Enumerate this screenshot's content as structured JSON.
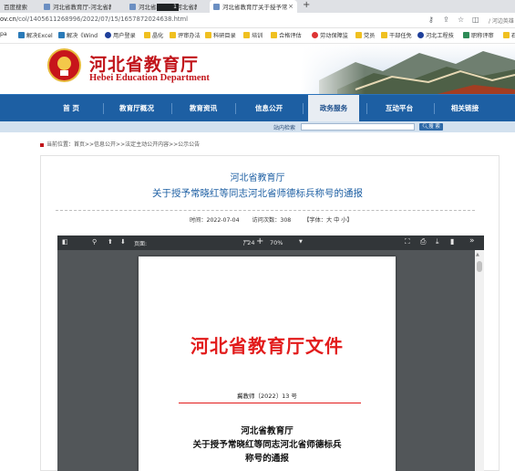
{
  "browser": {
    "tabs": [
      {
        "label": "百度搜索",
        "active": false
      },
      {
        "label": "河北省教育厅-河北省教",
        "active": false
      },
      {
        "label": "河北省教育厅-河北省教",
        "active": false
      },
      {
        "label": "河北省教育厅关于授予常",
        "active": true
      }
    ],
    "tab_close": "×",
    "new_tab": "+",
    "address": {
      "host": "ov.cn",
      "path": "/col/1405611268996/2022/07/15/1657872024638.html"
    },
    "login_label": "/ 河边英雄",
    "bookmarks": [
      {
        "label": "pa"
      },
      {
        "label": "解决Excel"
      },
      {
        "label": "解决《Wind"
      },
      {
        "label": "用户登录"
      },
      {
        "label": "晶化"
      },
      {
        "label": "评审办法"
      },
      {
        "label": "科研目录"
      },
      {
        "label": "培训"
      },
      {
        "label": "合格评估"
      },
      {
        "label": "劳动保障监"
      },
      {
        "label": "党员"
      },
      {
        "label": "干部任免"
      },
      {
        "label": "河北工程技"
      },
      {
        "label": "职称评审"
      },
      {
        "label": "石"
      }
    ]
  },
  "site": {
    "title_cn": "河北省教育厅",
    "title_en": "Hebei Education Department",
    "nav": [
      {
        "label": "首 页",
        "active": false
      },
      {
        "label": "教育厅概况",
        "active": false
      },
      {
        "label": "教育资讯",
        "active": false
      },
      {
        "label": "信息公开",
        "active": false
      },
      {
        "label": "政务服务",
        "active": true
      },
      {
        "label": "互动平台",
        "active": false
      },
      {
        "label": "相关链接",
        "active": false
      }
    ],
    "search_label": "站内检索",
    "search_button": "搜 索",
    "breadcrumb": "当前位置：首页>>信息公开>>法定主动公开内容>>公示公告"
  },
  "article": {
    "title_line1": "河北省教育厅",
    "title_line2": "关于授予常晓红等同志河北省师德标兵称号的通报",
    "date": "时间：2022-07-04",
    "views": "访问次数：308",
    "font_size": "【字体：大 中 小】"
  },
  "pdf": {
    "current_page": "1",
    "total_pages": "/ 24",
    "page_label": "页面:",
    "zoom": "70%",
    "doc_header": "河北省教育厅文件",
    "doc_number": "冀教师〔2022〕13 号",
    "subtitle_lines": [
      "河北省教育厅",
      "关于授予常晓红等同志河北省师德标兵",
      "称号的通报"
    ]
  },
  "colors": {
    "nav_blue": "#1d5fa3",
    "brand_red": "#c1141a",
    "doc_red": "#e21b1b",
    "pdf_dark": "#323639"
  }
}
